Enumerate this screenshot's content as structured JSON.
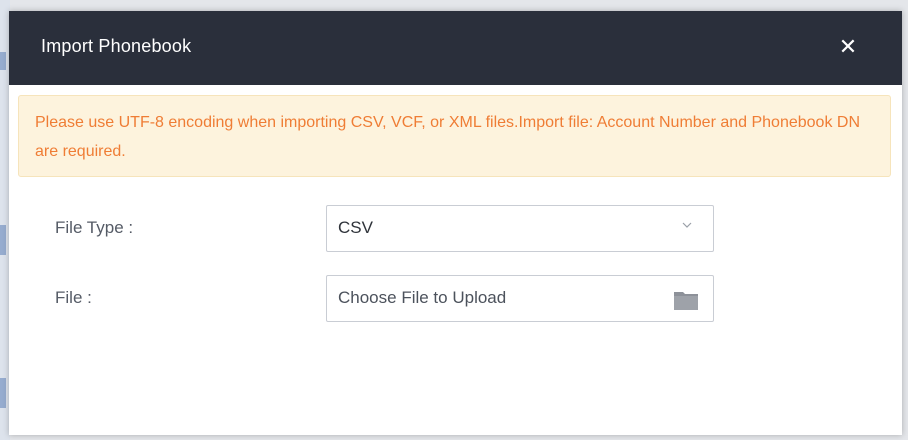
{
  "dialog": {
    "title": "Import Phonebook",
    "close_symbol": "✕"
  },
  "notice": {
    "text": "Please use UTF-8 encoding when importing CSV, VCF, or XML files.Import file: Account Number and Phonebook DN are required.",
    "color": "#ef7d35",
    "background": "#fdf3dd"
  },
  "form": {
    "file_type": {
      "label": "File Type :",
      "value": "CSV",
      "icon": "chevron-down-icon"
    },
    "file": {
      "label": "File :",
      "placeholder": "Choose File to Upload",
      "icon": "folder-icon"
    }
  },
  "colors": {
    "header": "#2a2f3b",
    "label": "#555b66"
  }
}
